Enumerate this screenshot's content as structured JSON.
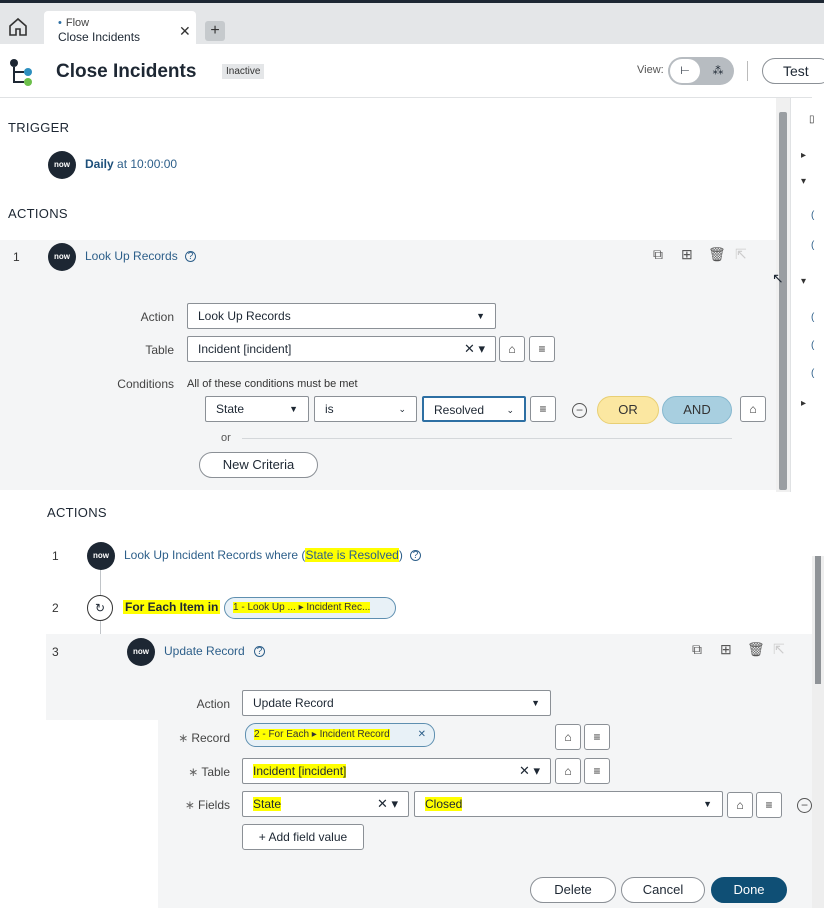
{
  "tabs": [
    {
      "subtitle": "Flow",
      "title": "Close Incidents"
    }
  ],
  "header": {
    "title": "Close Incidents",
    "status": "Inactive",
    "view_label": "View:",
    "test_label": "Test"
  },
  "upper": {
    "trigger_label": "TRIGGER",
    "trigger_name": "Daily",
    "trigger_time": "at 10:00:00",
    "actions_label": "ACTIONS",
    "step": {
      "number": "1",
      "name": "Look Up Records"
    },
    "form": {
      "action_label": "Action",
      "action_value": "Look Up Records",
      "table_label": "Table",
      "table_value": "Incident [incident]",
      "conditions_label": "Conditions",
      "conditions_hint": "All of these conditions must be met",
      "cond_field": "State",
      "cond_op": "is",
      "cond_value": "Resolved",
      "or_pill": "OR",
      "and_pill": "AND",
      "or_divider": "or",
      "new_criteria": "New Criteria"
    }
  },
  "lower": {
    "actions_label": "ACTIONS",
    "steps": [
      {
        "number": "1",
        "prefix": "Look Up Incident Records where (",
        "highlight": "State is Resolved",
        "suffix": ")"
      },
      {
        "number": "2",
        "label": "For Each Item in",
        "pill": "1 - Look Up ... ▸ Incident Rec..."
      },
      {
        "number": "3",
        "label": "Update Record"
      }
    ],
    "form": {
      "action_label": "Action",
      "action_value": "Update Record",
      "record_label": "Record",
      "record_pill": "2 - For Each ▸ Incident Record",
      "table_label": "Table",
      "table_value": "Incident [incident]",
      "fields_label": "Fields",
      "field_name": "State",
      "field_value": "Closed",
      "add_field": "+ Add field value"
    },
    "buttons": {
      "delete": "Delete",
      "cancel": "Cancel",
      "done": "Done"
    }
  }
}
